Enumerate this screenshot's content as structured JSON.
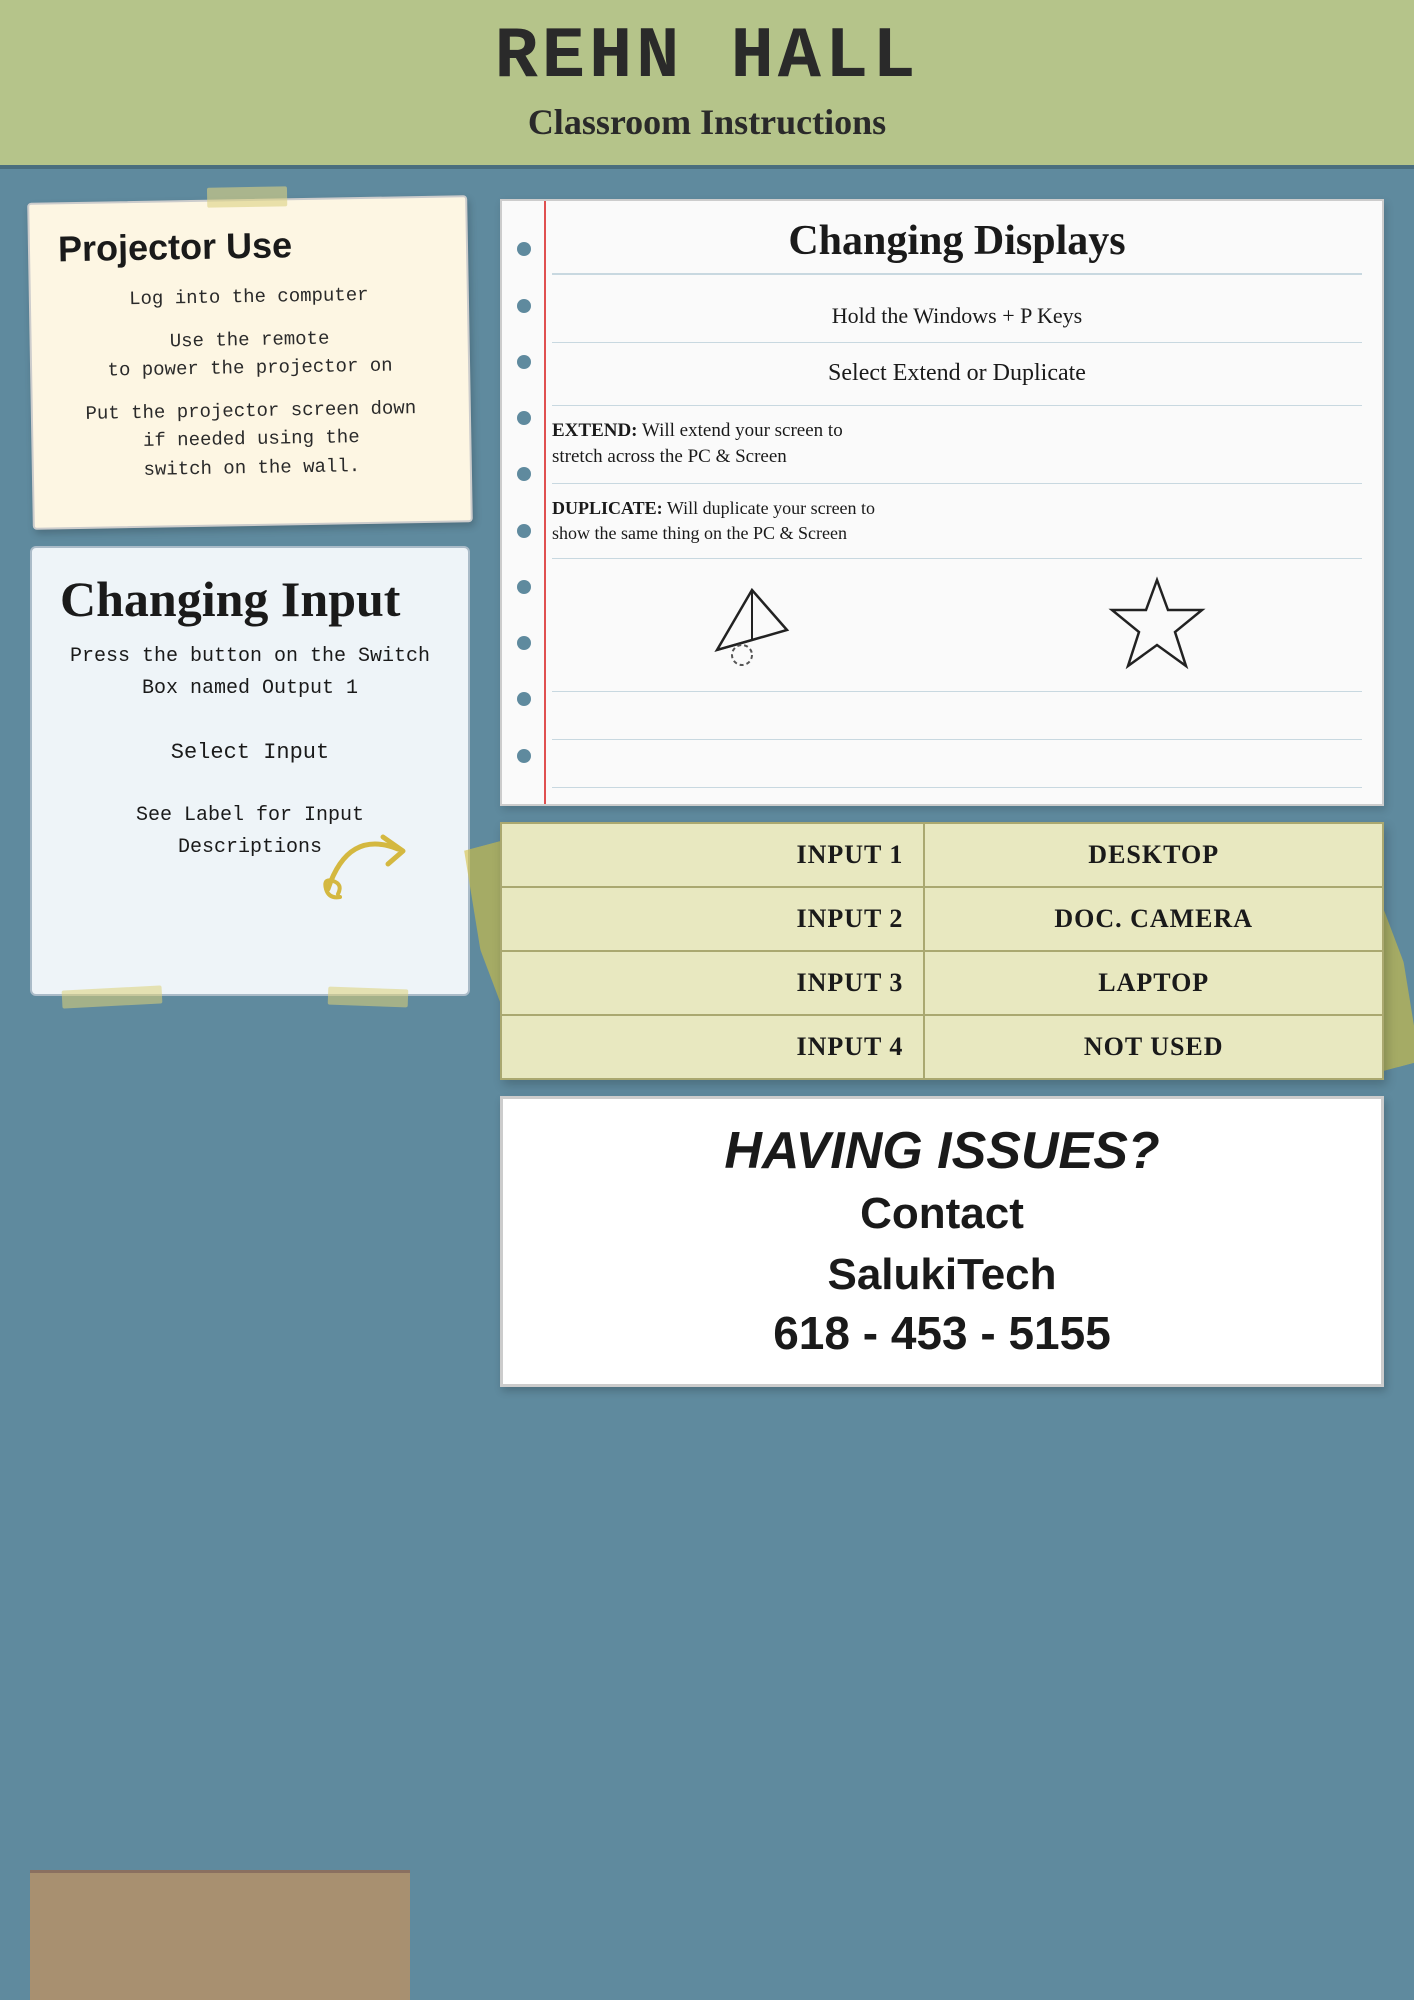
{
  "header": {
    "title": "REHN HALL",
    "subtitle": "Classroom Instructions"
  },
  "projector": {
    "title": "Projector Use",
    "steps": [
      "Log into the computer",
      "Use the remote\nto power the projector on",
      "Put the projector screen down\nif needed using the\nswitch on the wall."
    ]
  },
  "changing_displays": {
    "title": "Changing Displays",
    "steps": [
      "Hold the Windows + P Keys",
      "Select Extend or Duplicate",
      "EXTEND: Will extend your screen to\nstretch across the PC & Screen",
      "DUPLICATE: Will duplicate your screen to\nshow the same thing on the PC & Screen"
    ]
  },
  "changing_input": {
    "title": "Changing Input",
    "steps": [
      "Press the button on the Switch\nBox named Output 1",
      "Select Input",
      "See Label for Input Descriptions"
    ]
  },
  "input_table": {
    "rows": [
      {
        "input": "INPUT 1",
        "device": "DESKTOP"
      },
      {
        "input": "INPUT 2",
        "device": "DOC. CAMERA"
      },
      {
        "input": "INPUT 3",
        "device": "LAPTOP"
      },
      {
        "input": "INPUT 4",
        "device": "NOT USED"
      }
    ]
  },
  "having_issues": {
    "title": "HAVING ISSUES?",
    "line1": "Contact",
    "line2": "SalukiTech",
    "phone": "618 - 453 - 5155"
  }
}
